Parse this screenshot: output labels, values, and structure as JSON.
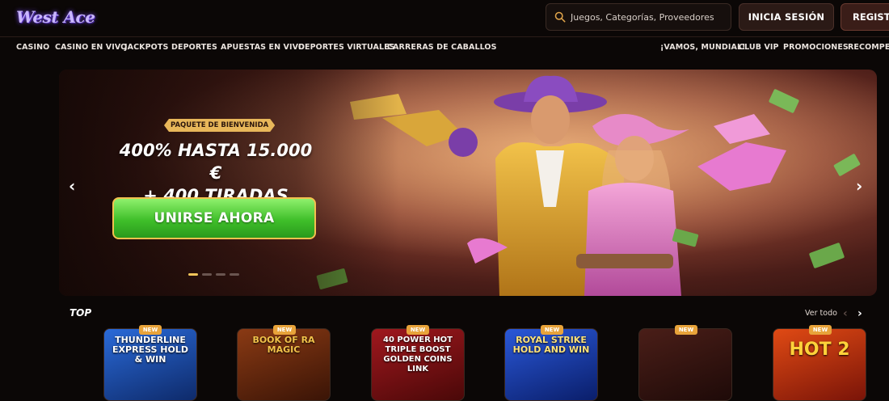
{
  "header": {
    "logo_text": "West Ace",
    "search_placeholder": "Juegos, Categorías, Proveedores",
    "login_label": "INICIA SESIÓN",
    "register_label": "REGISTRO"
  },
  "nav": {
    "left": [
      "CASINO",
      "CASINO EN VIVO",
      "JACKPOTS",
      "DEPORTES",
      "APUESTAS EN VIVO",
      "DEPORTES VIRTUALES",
      "CARRERAS DE CABALLOS"
    ],
    "right": [
      "¡VAMOS, MUNDIAL!",
      "CLUB VIP",
      "PROMOCIONES",
      "RECOMPENS"
    ]
  },
  "banner": {
    "tag": "PAQUETE DE BIENVENIDA",
    "headline_line1": "400% HASTA 15.000 €",
    "headline_line2": "+ 400 TIRADAS GRATIS",
    "cta_label": "UNIRSE AHORA",
    "slide_count": 4,
    "active_slide": 1
  },
  "top_section": {
    "title": "TOP",
    "see_all": "Ver todo",
    "games": [
      {
        "title": "THUNDERLINE EXPRESS HOLD & WIN",
        "badge": "NEW",
        "bg": "#1d4fb0"
      },
      {
        "title": "BOOK OF RA MAGIC",
        "badge": "NEW",
        "bg": "#6a2a10"
      },
      {
        "title": "40 POWER HOT TRIPLE BOOST GOLDEN COINS LINK",
        "badge": "NEW",
        "bg": "#7a1418"
      },
      {
        "title": "ROYAL STRIKE HOLD AND WIN",
        "badge": "NEW",
        "bg": "#1a3aa0"
      },
      {
        "title": "",
        "badge": "NEW",
        "bg": "#3a1814"
      },
      {
        "title": "HOT 2",
        "badge": "NEW",
        "bg": "#b02a10"
      }
    ]
  },
  "colors": {
    "background": "#0b0706",
    "accent_gold": "#f0c55a",
    "cta_green": "#3fbf2a"
  }
}
